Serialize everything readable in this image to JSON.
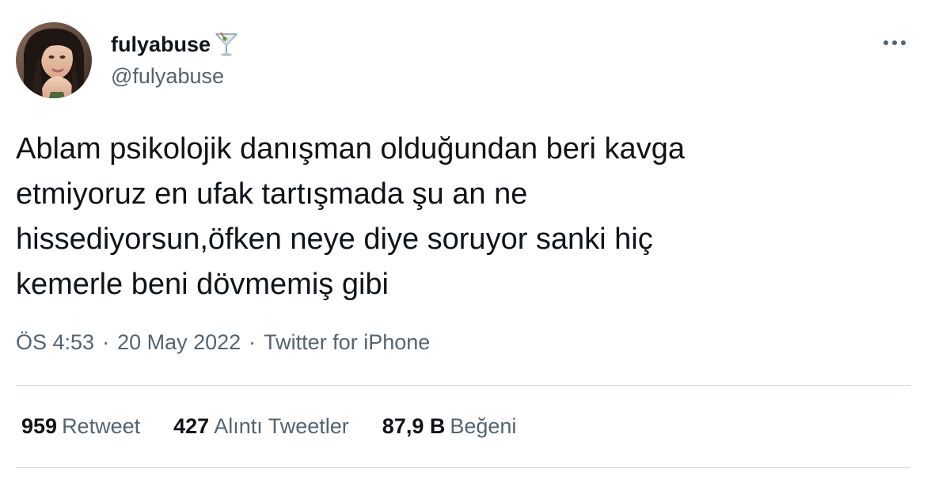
{
  "user": {
    "display_name": "fulyabuse",
    "handle": "@fulyabuse",
    "emoji_icon": "cocktail-glass-icon"
  },
  "tweet": {
    "lines": [
      "Ablam psikolojik danışman olduğundan beri kavga",
      "etmiyoruz en ufak tartışmada şu an ne",
      "hissediyorsun,öfken neye diye soruyor sanki hiç",
      "kemerle beni dövmemiş gibi"
    ]
  },
  "meta": {
    "time": "ÖS 4:53",
    "separator": "·",
    "date": "20 May 2022",
    "source": "Twitter for iPhone"
  },
  "stats": {
    "retweets": {
      "count": "959",
      "label": "Retweet"
    },
    "quotes": {
      "count": "427",
      "label": "Alıntı Tweetler"
    },
    "likes": {
      "count": "87,9 B",
      "label": "Beğeni"
    }
  },
  "colors": {
    "text_primary": "#0f1419",
    "text_secondary": "#536471",
    "divider": "#cfd9de"
  }
}
